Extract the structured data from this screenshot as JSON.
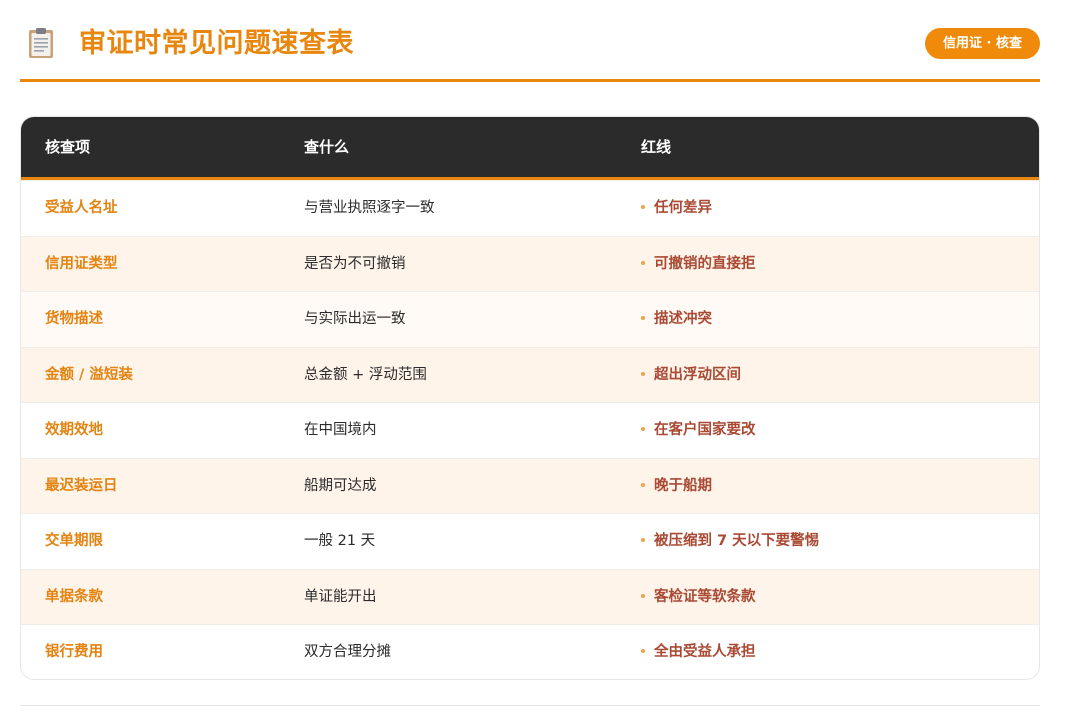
{
  "header": {
    "title": "审证时常见问题速查表",
    "badge": "信用证 · 核查",
    "icon": "clipboard-icon"
  },
  "colors": {
    "accent": "#e8870f",
    "header_bg": "#2b2b2b",
    "redline": "#a94a35",
    "badge_bg": "#ef8a0b"
  },
  "table": {
    "columns": [
      "核查项",
      "查什么",
      "红线"
    ],
    "rows": [
      {
        "item": "受益人名址",
        "check": "与营业执照逐字一致",
        "redline": "任何差异"
      },
      {
        "item": "信用证类型",
        "check": "是否为不可撤销",
        "redline": "可撤销的直接拒"
      },
      {
        "item": "货物描述",
        "check": "与实际出运一致",
        "redline": "描述冲突"
      },
      {
        "item": "金额 / 溢短装",
        "check": "总金额 + 浮动范围",
        "redline": "超出浮动区间"
      },
      {
        "item": "效期效地",
        "check": "在中国境内",
        "redline": "在客户国家要改"
      },
      {
        "item": "最迟装运日",
        "check": "船期可达成",
        "redline": "晚于船期"
      },
      {
        "item": "交单期限",
        "check": "一般 21 天",
        "redline": "被压缩到 7 天以下要警惕"
      },
      {
        "item": "单据条款",
        "check": "单证能开出",
        "redline": "客检证等软条款"
      },
      {
        "item": "银行费用",
        "check": "双方合理分摊",
        "redline": "全由受益人承担"
      }
    ]
  }
}
